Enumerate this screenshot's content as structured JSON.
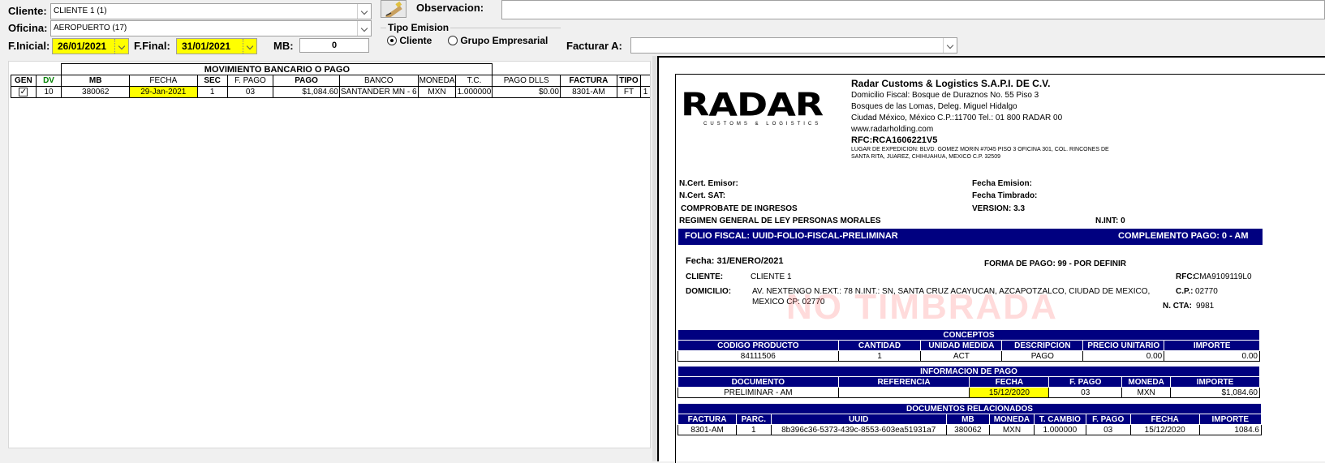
{
  "form": {
    "cliente_label": "Cliente:",
    "cliente_value": "CLIENTE 1 (1)",
    "oficina_label": "Oficina:",
    "oficina_value": "AEROPUERTO (17)",
    "finicial_label": "F.Inicial:",
    "finicial_value": "26/01/2021",
    "ffinal_label": "F.Final:",
    "ffinal_value": "31/01/2021",
    "mb_label": "MB:",
    "mb_value": "0",
    "observacion_label": "Observacion:",
    "observacion_value": "",
    "tipo_emision_label": "Tipo Emision",
    "radio_cliente": "Cliente",
    "radio_grupo": "Grupo Empresarial",
    "facturar_label": "Facturar A:",
    "facturar_value": ""
  },
  "grid": {
    "group_header": "MOVIMIENTO BANCARIO O PAGO",
    "columns": [
      "GEN",
      "DV",
      "MB",
      "FECHA",
      "SEC",
      "F. PAGO",
      "PAGO",
      "BANCO",
      "MONEDA",
      "T.C.",
      "PAGO DLLS",
      "FACTURA",
      "TIPO"
    ],
    "rows": [
      {
        "gen": true,
        "dv": "10",
        "mb": "380062",
        "fecha": "29-Jan-2021",
        "sec": "1",
        "fpago": "03",
        "pago": "$1,084.60",
        "banco": "SANTANDER MN - 6",
        "moneda": "MXN",
        "tc": "1.000000",
        "pago_dlls": "$0.00",
        "factura": "8301-AM",
        "tipo": "FT",
        "extra": "1"
      }
    ]
  },
  "invoice": {
    "company": "Radar Customs & Logistics S.A.P.I. DE C.V.",
    "address1": "Domicilio Fiscal: Bosque de Duraznos No. 55 Piso 3",
    "address2": "Bosques de las Lomas, Deleg. Miguel Hidalgo",
    "address3": "Ciudad México, México C.P.:11700 Tel.: 01 800 RADAR 00",
    "website": "www.radarholding.com",
    "rfc": "RFC:RCA1606221V5",
    "lugar1": "LUGAR DE EXPEDICION: BLVD. GOMEZ MORIN #7045 PISO 3 OFICINA 301, COL. RINCONES DE",
    "lugar2": "SANTA RITA, JUAREZ, CHIHUAHUA, MEXICO C.P. 32509",
    "logo_text": "RADAR",
    "logo_sub": "CUSTOMS & LOGISTICS",
    "cert_emisor": "N.Cert. Emisor:",
    "cert_sat": "N.Cert. SAT:",
    "comprobante": "COMPROBATE DE INGRESOS",
    "regimen": "REGIMEN GENERAL DE LEY PERSONAS MORALES",
    "fecha_emision": "Fecha Emision:",
    "fecha_timbrado": "Fecha Timbrado:",
    "version": "VERSION: 3.3",
    "nint": "N.INT: 0",
    "folio": "FOLIO FISCAL: UUID-FOLIO-FISCAL-PRELIMINAR",
    "complemento": "COMPLEMENTO PAGO: 0 - AM",
    "fecha": "Fecha: 31/ENERO/2021",
    "forma_pago": "FORMA DE PAGO:  99 - POR DEFINIR",
    "cliente_label": "CLIENTE:",
    "cliente_value": "CLIENTE 1",
    "rfc_label": "RFC:",
    "rfc_value": "CMA9109119L0",
    "domicilio_label": "DOMICILIO:",
    "domicilio_value1": "AV. NEXTENGO N.EXT.: 78 N.INT.: SN, SANTA CRUZ ACAYUCAN, AZCAPOTZALCO, CIUDAD DE MEXICO,",
    "domicilio_value2": "MEXICO CP: 02770",
    "cp_label": "C.P.:",
    "cp_value": "02770",
    "ncta_label": "N. CTA:",
    "ncta_value": "9981",
    "watermark": "NO TIMBRADA",
    "conceptos_title": "CONCEPTOS",
    "conceptos_cols": [
      "CODIGO PRODUCTO",
      "CANTIDAD",
      "UNIDAD MEDIDA",
      "DESCRIPCION",
      "PRECIO UNITARIO",
      "IMPORTE"
    ],
    "conceptos_row": [
      "84111506",
      "1",
      "ACT",
      "PAGO",
      "0.00",
      "0.00"
    ],
    "info_title": "INFORMACION DE PAGO",
    "info_cols": [
      "DOCUMENTO",
      "REFERENCIA",
      "FECHA",
      "F. PAGO",
      "MONEDA",
      "IMPORTE"
    ],
    "info_row": [
      "PRELIMINAR - AM",
      "",
      "15/12/2020",
      "03",
      "MXN",
      "$1,084.60"
    ],
    "docs_title": "DOCUMENTOS RELACIONADOS",
    "docs_cols": [
      "FACTURA",
      "PARC.",
      "UUID",
      "MB",
      "MONEDA",
      "T. CAMBIO",
      "F. PAGO",
      "FECHA",
      "IMPORTE"
    ],
    "docs_row": [
      "8301-AM",
      "1",
      "8b396c36-5373-439c-8553-603ea51931a7",
      "380062",
      "MXN",
      "1.000000",
      "03",
      "15/12/2020",
      "1084.6"
    ]
  },
  "colors": {
    "highlight": "#ffff00",
    "band": "#000080",
    "watermark": "#ff5a5a"
  }
}
